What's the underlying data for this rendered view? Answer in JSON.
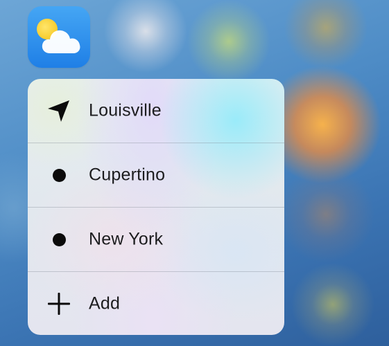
{
  "app_icon": {
    "icon": "weather-app-icon",
    "colors": {
      "background": "#2b8ff0",
      "sun": "#f7cc2c",
      "cloud": "#ffffff"
    }
  },
  "menu": {
    "items": [
      {
        "label": "Louisville",
        "icon": "location-arrow-icon"
      },
      {
        "label": "Cupertino",
        "icon": "bullet-dot-icon"
      },
      {
        "label": "New York",
        "icon": "bullet-dot-icon"
      },
      {
        "label": "Add",
        "icon": "plus-icon"
      }
    ]
  }
}
